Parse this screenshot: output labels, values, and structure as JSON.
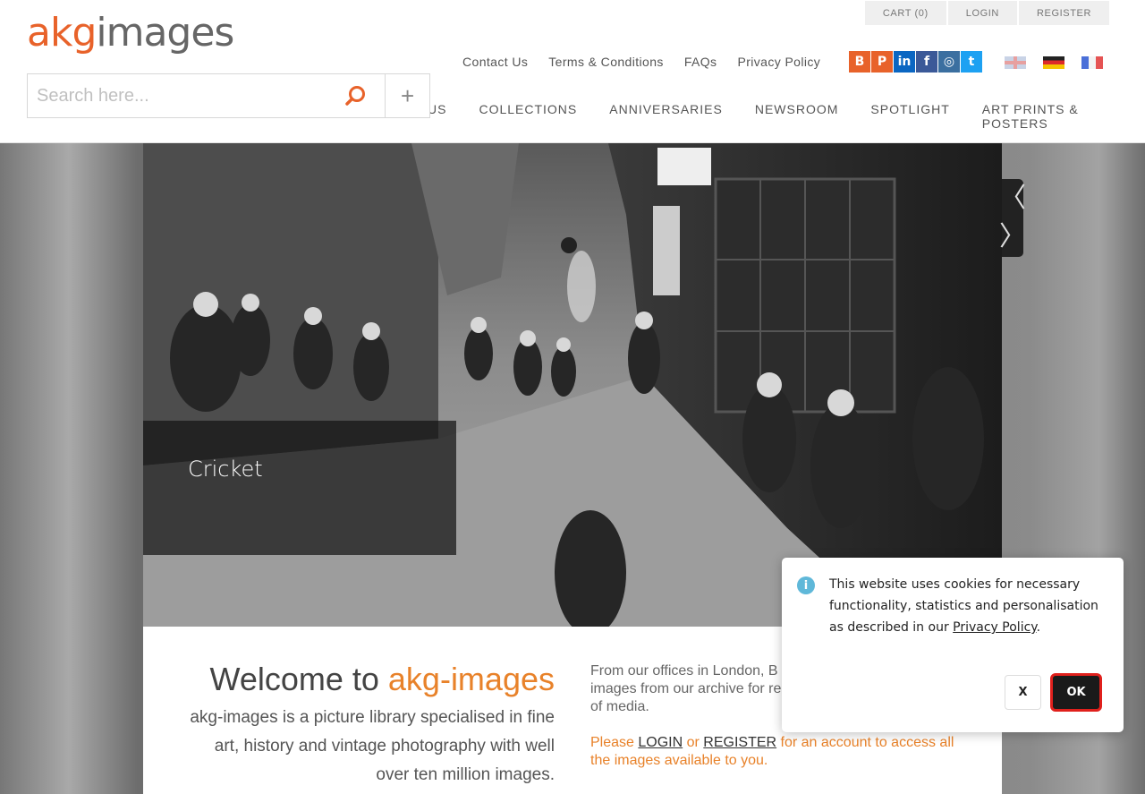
{
  "logo": {
    "part1": "akg",
    "part2": "images"
  },
  "account": {
    "cart": "CART (0)",
    "login": "LOGIN",
    "register": "REGISTER"
  },
  "toplinks": [
    "Contact Us",
    "Terms & Conditions",
    "FAQs",
    "Privacy Policy"
  ],
  "social": [
    {
      "icon": "blog-icon",
      "glyph": "B"
    },
    {
      "icon": "pinterest-icon",
      "glyph": "P"
    },
    {
      "icon": "linkedin-icon",
      "glyph": "in"
    },
    {
      "icon": "facebook-icon",
      "glyph": "f"
    },
    {
      "icon": "instagram-icon",
      "glyph": "◎"
    },
    {
      "icon": "twitter-icon",
      "glyph": "t"
    }
  ],
  "search": {
    "placeholder": "Search here...",
    "plus": "+"
  },
  "nav": [
    "US",
    "COLLECTIONS",
    "ANNIVERSARIES",
    "NEWSROOM",
    "SPOTLIGHT",
    "ART PRINTS & POSTERS"
  ],
  "hero": {
    "caption": "Cricket",
    "prev": "〈",
    "next": "〉"
  },
  "welcome": {
    "title_prefix": "Welcome to ",
    "title_brand": "akg-images",
    "text": "akg-images is a picture library specialised in fine art, history and vintage photography with well over ten million images.",
    "right_text": "From our offices in London, B... images from our archive for re... of media.",
    "right_line1": "From our offices in London, B",
    "right_line2": "images from our archive for re",
    "right_line3": "of media.",
    "please": "Please ",
    "login": "LOGIN",
    "or": " or ",
    "register": "REGISTER",
    "account_text": " for an account to access all the images available to you."
  },
  "cookie": {
    "message": "This website uses cookies for necessary functionality, statistics and personalisation as described in our ",
    "link": "Privacy Policy",
    "period": ".",
    "x_label": "X",
    "ok_label": "OK",
    "info_glyph": "i"
  },
  "colors": {
    "brand": "#e8622a",
    "ok_border": "#e0201c"
  }
}
